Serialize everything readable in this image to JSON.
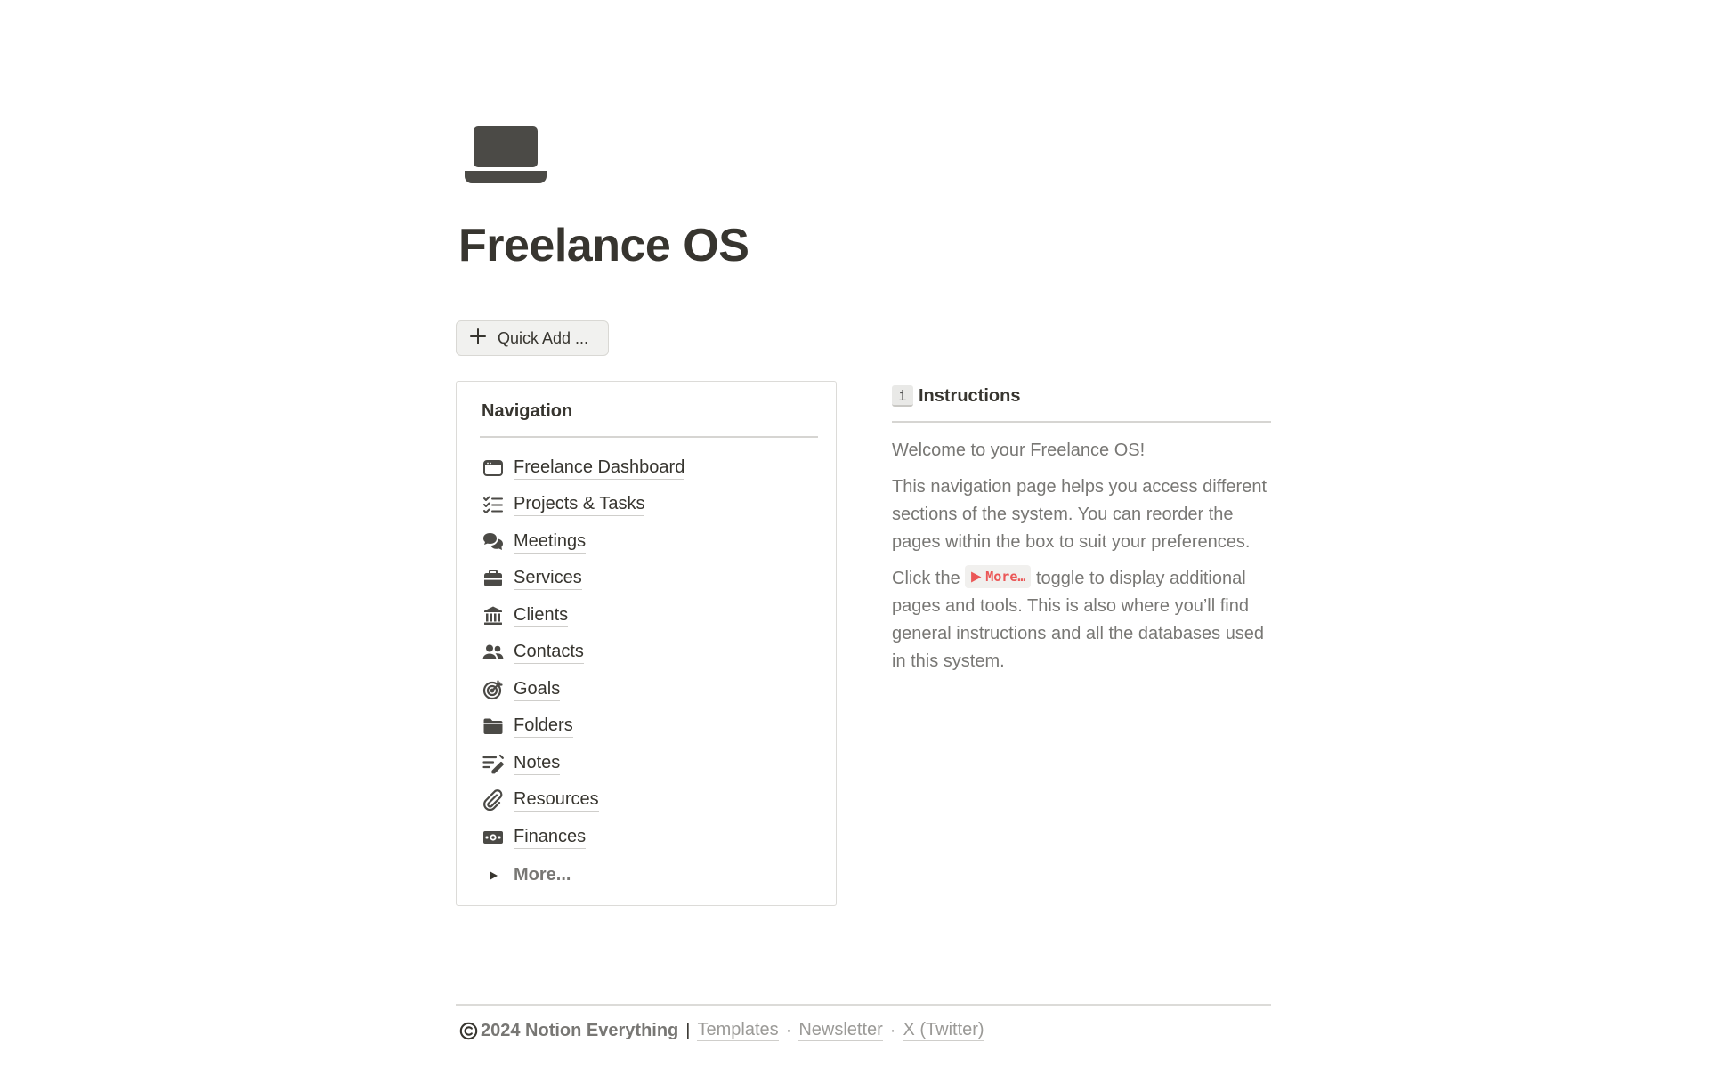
{
  "page": {
    "icon": "laptop-icon",
    "title": "Freelance OS"
  },
  "quick_add": {
    "label": "Quick Add ...",
    "icon": "plus-icon"
  },
  "navigation": {
    "heading": "Navigation",
    "items": [
      {
        "label": "Freelance Dashboard",
        "icon": "browser-window-icon"
      },
      {
        "label": "Projects & Tasks",
        "icon": "checklist-icon"
      },
      {
        "label": "Meetings",
        "icon": "chat-bubbles-icon"
      },
      {
        "label": "Services",
        "icon": "briefcase-icon"
      },
      {
        "label": "Clients",
        "icon": "bank-building-icon"
      },
      {
        "label": "Contacts",
        "icon": "people-icon"
      },
      {
        "label": "Goals",
        "icon": "target-icon"
      },
      {
        "label": "Folders",
        "icon": "folder-icon"
      },
      {
        "label": "Notes",
        "icon": "notes-pencil-icon"
      },
      {
        "label": "Resources",
        "icon": "paperclip-icon"
      },
      {
        "label": "Finances",
        "icon": "banknote-icon"
      }
    ],
    "more_toggle": "More..."
  },
  "instructions": {
    "badge": "i",
    "title": "Instructions",
    "p1": "Welcome to your Freelance OS!",
    "p2": "This navigation page helps you access different sections of the system. You can reorder the pages within the box to suit your preferences.",
    "p3_before": "Click the ",
    "p3_code": "More…",
    "p3_after": " toggle to display additional pages and tools. This is also where you’ll find general instructions and all the databases used in this system."
  },
  "footer": {
    "copyright": "2024 Notion Everything",
    "separator": "|",
    "links": [
      "Templates",
      "Newsletter",
      "X (Twitter)"
    ],
    "dot": "·"
  }
}
